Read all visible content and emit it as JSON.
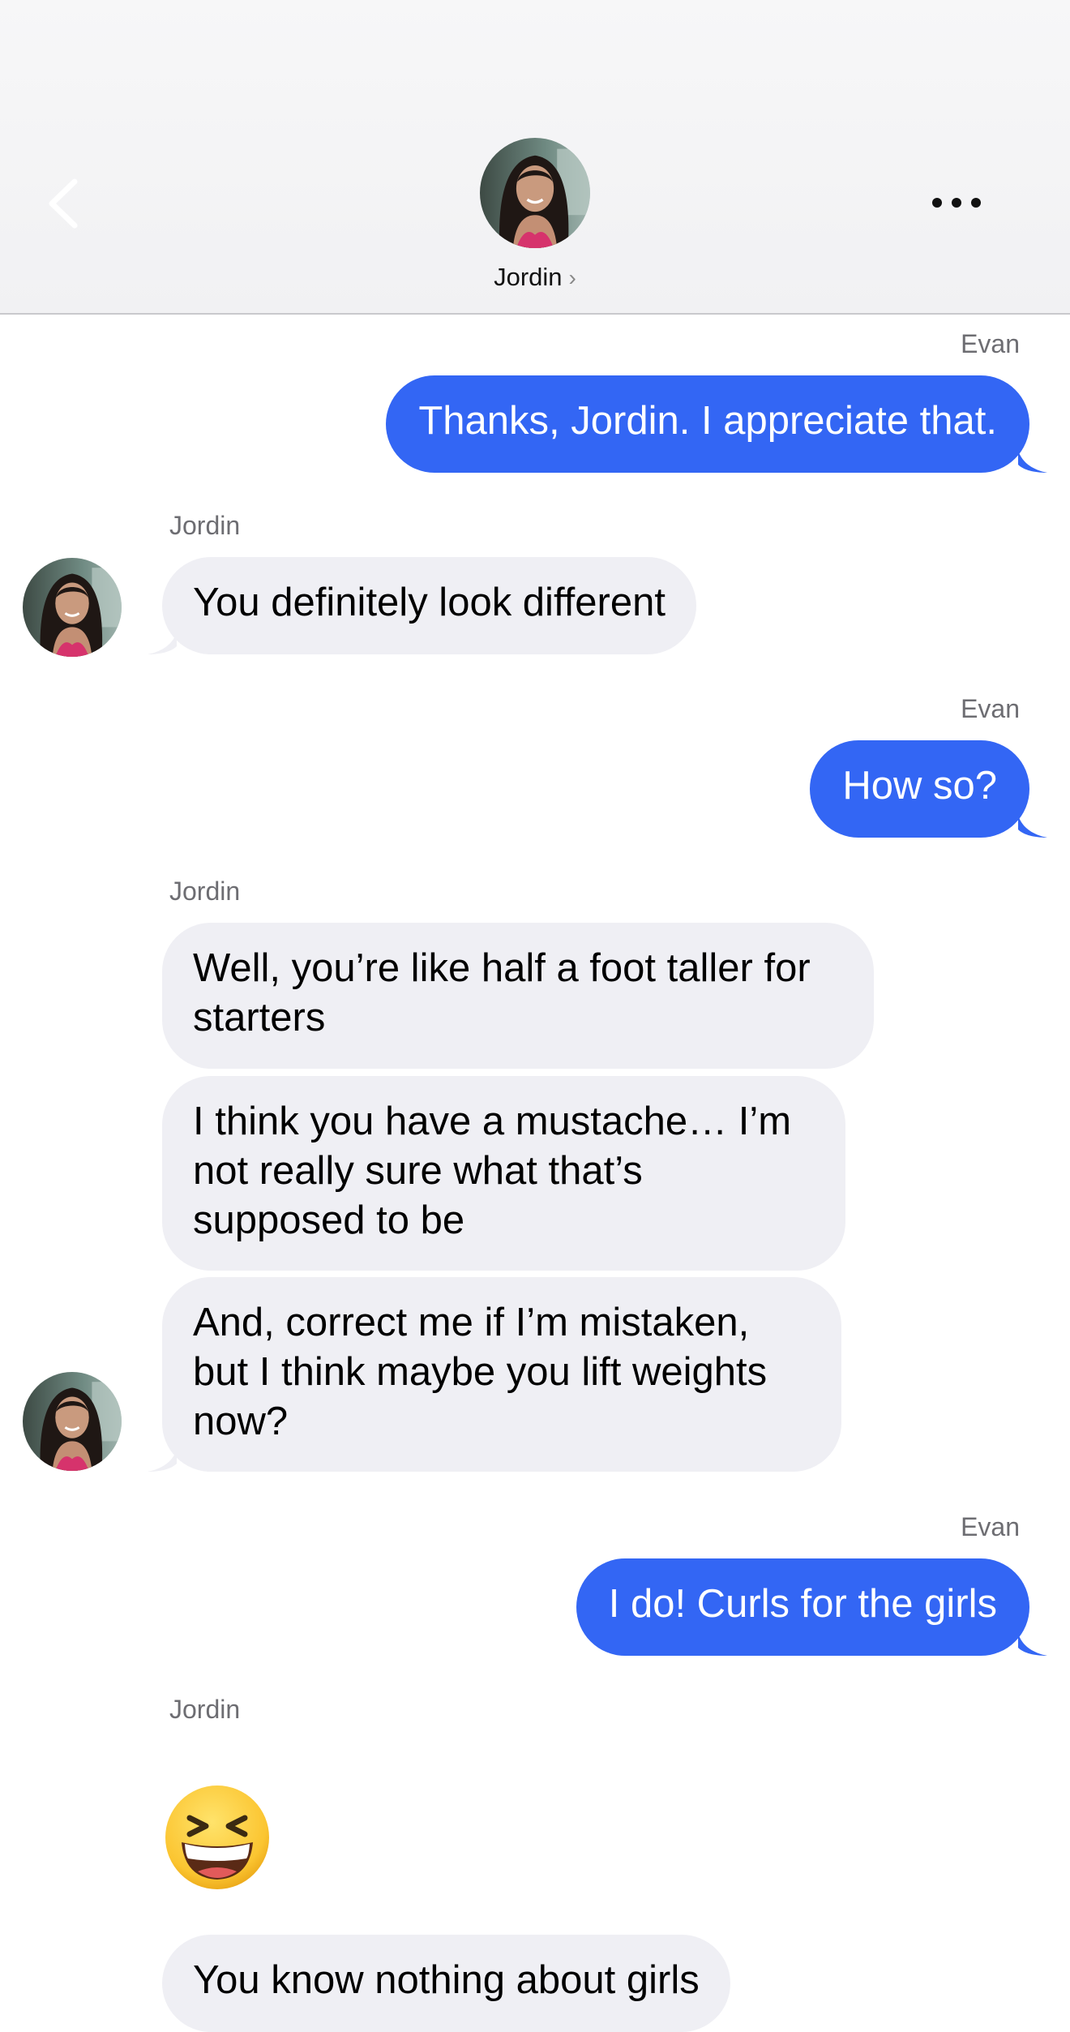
{
  "header": {
    "contact_name": "Jordin",
    "chevron": "›",
    "back_icon": "chevron-left-icon",
    "more_icon": "ellipsis-icon"
  },
  "colors": {
    "outgoing_bubble": "#3366f4",
    "incoming_bubble": "#efeff4",
    "sender_label": "#6d6d72"
  },
  "messages": [
    {
      "sender": "Evan",
      "text": "Thanks, Jordin. I appreciate that."
    },
    {
      "sender": "Jordin",
      "text": "You definitely look different"
    },
    {
      "sender": "Evan",
      "text": "How so?"
    },
    {
      "sender": "Jordin",
      "text": "Well, you’re like half a foot taller for starters"
    },
    {
      "text": "I think you have a mustache… I’m not really sure what that’s supposed to be"
    },
    {
      "text": "And, correct me if I’m mistaken, but I think maybe you lift weights now?"
    },
    {
      "sender": "Evan",
      "text": "I do! Curls for the girls"
    },
    {
      "sender": "Jordin",
      "emoji": "grinning-squinting-face-emoji"
    },
    {
      "text": "You know nothing about girls"
    }
  ]
}
